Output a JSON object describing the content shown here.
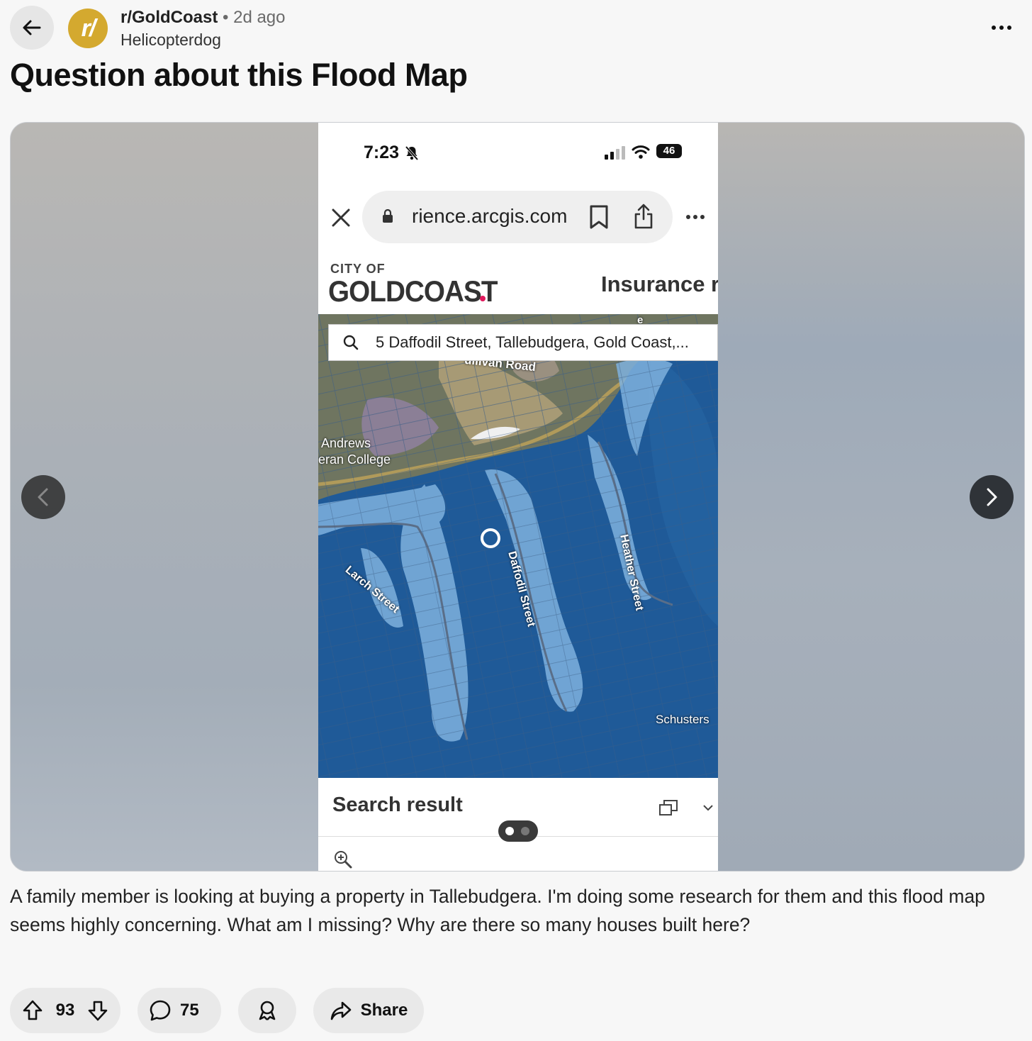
{
  "header": {
    "subreddit": "r/GoldCoast",
    "separator": "•",
    "age": "2d ago",
    "author": "Helicopterdog",
    "avatar_text": "r/"
  },
  "post": {
    "title": "Question about this Flood Map",
    "body": "A family member is looking at buying a property in Tallebudgera. I'm doing some research for them and this flood map seems highly concerning. What am I missing? Why are there so many houses built here?"
  },
  "screenshot": {
    "status_time": "7:23",
    "battery": "46",
    "url": "rience.arcgis.com",
    "brand_small": "CITY OF",
    "brand_large": "GOLDCOAST",
    "header_right": "Insurance r",
    "search_text": "5 Daffodil Street, Tallebudgera, Gold Coast,...",
    "map_labels": {
      "road_top": "ullivan Road",
      "college_1": "Andrews",
      "college_2": "eran College",
      "larch": "Larch Street",
      "daffodil": "Daffodil Street",
      "heather": "Heather Street",
      "schusters": "Schusters",
      "road_corner": "e"
    },
    "result_title": "Search result"
  },
  "actions": {
    "upvotes": "93",
    "comments": "75",
    "share_label": "Share"
  },
  "colors": {
    "avatar": "#d4a92f",
    "flood_deep": "#1f5a98",
    "flood_shallow": "#7fb2de",
    "brand_dot": "#e0195c"
  }
}
